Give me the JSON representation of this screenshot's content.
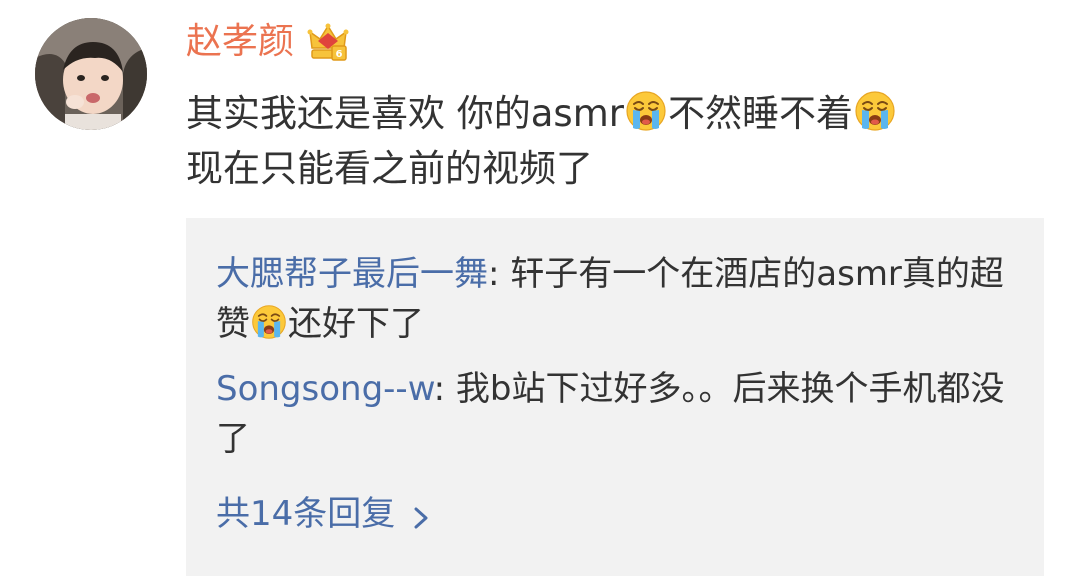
{
  "comment": {
    "username": "赵孝颜",
    "badge_icon": "crown-badge-icon",
    "text_part1": "其实我还是喜欢 你的asmr",
    "text_part2": "不然睡不着",
    "text_part3": "现在只能看之前的视频了",
    "emoji": "crying-face-emoji"
  },
  "replies": [
    {
      "author": "大腮帮子最后一舞",
      "separator": ": ",
      "text_part1": "轩子有一个在酒店的asmr真的超赞",
      "text_part2": "还好下了"
    },
    {
      "author": "Songsong--w",
      "separator": ": ",
      "text": "我b站下过好多。。后来换个手机都没了"
    }
  ],
  "more_replies_label": "共14条回复",
  "colors": {
    "username": "#eb7350",
    "link": "#4a6da8",
    "text": "#333333",
    "reply_bg": "#f2f2f2"
  }
}
